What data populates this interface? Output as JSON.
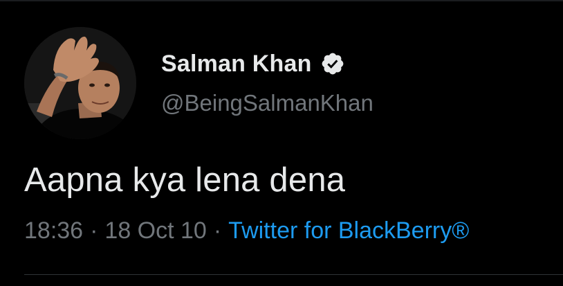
{
  "author": {
    "display_name": "Salman Khan",
    "handle": "@BeingSalmanKhan",
    "verified": true
  },
  "tweet": {
    "text": "Aapna kya lena dena"
  },
  "meta": {
    "time": "18:36",
    "separator": "·",
    "date": "18 Oct 10",
    "source": "Twitter for BlackBerry®"
  },
  "colors": {
    "background": "#000000",
    "primary_text": "#e7e9ea",
    "secondary_text": "#71767b",
    "link": "#1d9bf0",
    "verified_badge": "#e7e9ea"
  },
  "icons": {
    "verified": "verified-badge-icon"
  }
}
